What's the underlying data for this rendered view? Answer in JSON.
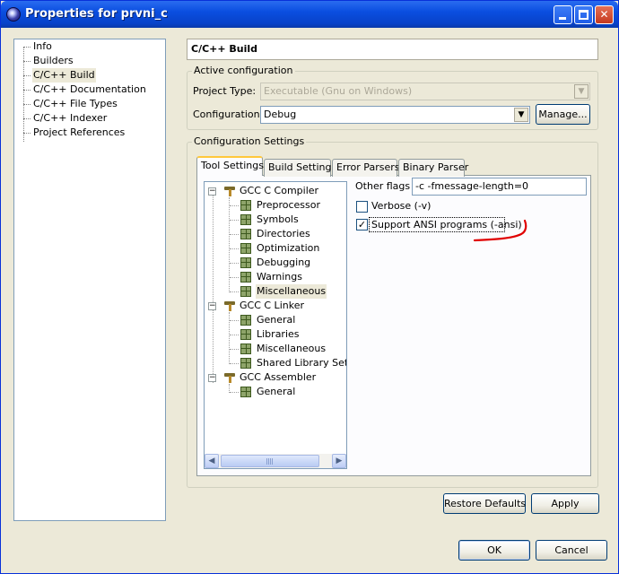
{
  "window": {
    "title": "Properties for prvni_c"
  },
  "nav": {
    "items": [
      {
        "label": "Info"
      },
      {
        "label": "Builders"
      },
      {
        "label": "C/C++ Build"
      },
      {
        "label": "C/C++ Documentation"
      },
      {
        "label": "C/C++ File Types"
      },
      {
        "label": "C/C++ Indexer"
      },
      {
        "label": "Project References"
      }
    ],
    "selected": "C/C++ Build"
  },
  "page": {
    "title": "C/C++ Build"
  },
  "active_config": {
    "group_label": "Active configuration",
    "project_type_label": "Project Type:",
    "project_type_value": "Executable (Gnu on Windows)",
    "configuration_label": "Configuration:",
    "configuration_value": "Debug",
    "manage_label": "Manage..."
  },
  "config_settings": {
    "group_label": "Configuration Settings",
    "tabs": [
      {
        "label": "Tool Settings"
      },
      {
        "label": "Build Settings"
      },
      {
        "label": "Error Parsers"
      },
      {
        "label": "Binary Parser"
      }
    ],
    "active_tab": "Tool Settings",
    "tree": [
      {
        "label": "GCC C Compiler",
        "children": [
          "Preprocessor",
          "Symbols",
          "Directories",
          "Optimization",
          "Debugging",
          "Warnings",
          "Miscellaneous"
        ]
      },
      {
        "label": "GCC C Linker",
        "children": [
          "General",
          "Libraries",
          "Miscellaneous",
          "Shared Library Settin"
        ]
      },
      {
        "label": "GCC Assembler",
        "children": [
          "General"
        ]
      }
    ],
    "selected_tree_item": "Miscellaneous",
    "other_flags_label": "Other flags",
    "other_flags_value": "-c -fmessage-length=0",
    "verbose_label": "Verbose (-v)",
    "verbose_checked": false,
    "ansi_label": "Support ANSI programs (-ansi)",
    "ansi_checked": true,
    "annotation_color": "#e00000"
  },
  "buttons": {
    "restore_defaults": "Restore Defaults",
    "apply": "Apply",
    "ok": "OK",
    "cancel": "Cancel"
  },
  "colors": {
    "titlebar": "#0a4ee0",
    "dialog_bg": "#ece9d8",
    "close_button": "#c5391f",
    "tab_highlight": "#ffc83c"
  }
}
